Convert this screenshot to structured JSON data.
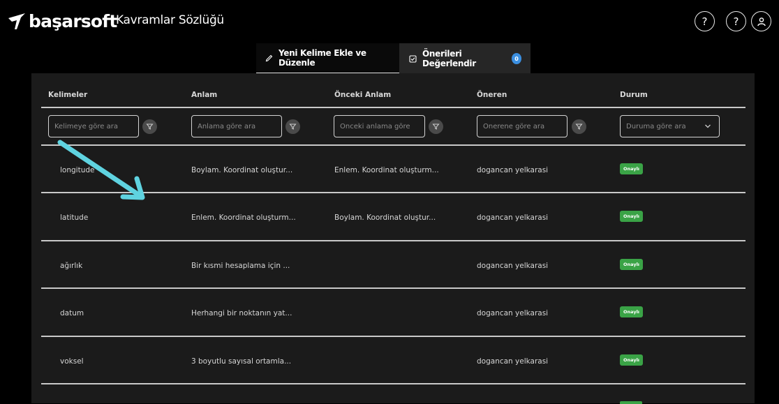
{
  "header": {
    "brand": "başarsoft",
    "app_title": "Kavramlar Sözlüğü",
    "icons": [
      "help-icon",
      "help-icon",
      "user-icon"
    ]
  },
  "tabs": [
    {
      "label": "Yeni Kelime Ekle ve Düzenle",
      "icon": "pencil-icon",
      "active": true
    },
    {
      "label": "Önerileri Değerlendir",
      "icon": "checkbox-icon",
      "active": false,
      "badge": "0"
    }
  ],
  "table": {
    "columns": [
      "Kelimeler",
      "Anlam",
      "Önceki Anlam",
      "Öneren",
      "Durum"
    ],
    "filters": {
      "kelime_placeholder": "Kelimeye göre ara",
      "anlam_placeholder": "Anlama göre ara",
      "onceki_placeholder": "Önceki anlama göre",
      "oneren_placeholder": "Önerene göre ara",
      "durum_placeholder": "Duruma göre ara"
    },
    "rows": [
      {
        "kelime": "longitude",
        "anlam": "Boylam. Koordinat oluştur...",
        "onceki": "Enlem. Koordinat oluşturm...",
        "oneren": "dogancan yelkarasi",
        "durum": "Onaylı"
      },
      {
        "kelime": "latitude",
        "anlam": "Enlem. Koordinat oluşturm...",
        "onceki": "Boylam. Koordinat oluştur...",
        "oneren": "dogancan yelkarasi",
        "durum": "Onaylı"
      },
      {
        "kelime": "ağırlık",
        "anlam": "Bir kısmi hesaplama için ...",
        "onceki": "",
        "oneren": "dogancan yelkarasi",
        "durum": "Onaylı"
      },
      {
        "kelime": "datum",
        "anlam": "Herhangi bir noktanın yat...",
        "onceki": "",
        "oneren": "dogancan yelkarasi",
        "durum": "Onaylı"
      },
      {
        "kelime": "voksel",
        "anlam": "3 boyutlu sayısal ortamla...",
        "onceki": "",
        "oneren": "dogancan yelkarasi",
        "durum": "Onaylı"
      }
    ]
  },
  "colors": {
    "accent_badge": "#3b8fe0",
    "status_green": "#3aa346",
    "annotation_arrow": "#5fd3e0"
  }
}
